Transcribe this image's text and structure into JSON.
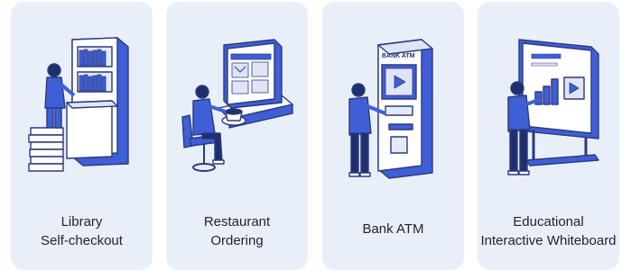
{
  "colors": {
    "card_bg": "#e9eff9",
    "accent": "#3f5fd6",
    "dark": "#1f2f6e",
    "line": "#2b3a7c",
    "text": "#1e2130"
  },
  "cards": [
    {
      "icon": "library-self-checkout-illustration",
      "caption": [
        "Library",
        "Self-checkout"
      ]
    },
    {
      "icon": "restaurant-ordering-illustration",
      "caption": [
        "Restaurant",
        "Ordering"
      ]
    },
    {
      "icon": "bank-atm-illustration",
      "caption": [
        "Bank ATM"
      ],
      "screen_label": "BANK ATM"
    },
    {
      "icon": "interactive-whiteboard-illustration",
      "caption": [
        "Educational",
        "Interactive Whiteboard"
      ]
    }
  ]
}
